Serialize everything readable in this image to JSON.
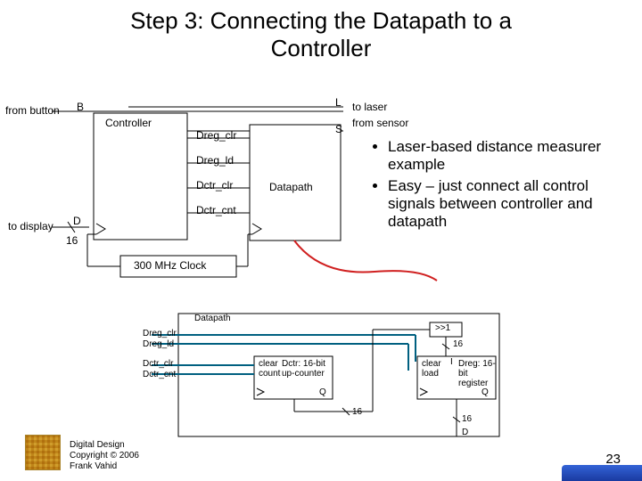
{
  "title_line1": "Step 3: Connecting the Datapath to a",
  "title_line2": "Controller",
  "top": {
    "from_button": "from button",
    "to_display": "to display",
    "B": "B",
    "D": "D",
    "controller": "Controller",
    "datapath": "Datapath",
    "dreg_clr": "Dreg_clr",
    "dreg_ld": "Dreg_ld",
    "dctr_clr": "Dctr_clr",
    "dctr_cnt": "Dctr_cnt",
    "L": "L",
    "S": "S",
    "to_laser": "to laser",
    "from_sensor": "from sensor",
    "bus16": "16",
    "clock": "300 MHz Clock"
  },
  "bullets": [
    "Laser-based distance measurer example",
    "Easy – just connect all control signals between controller and datapath"
  ],
  "bottom": {
    "datapath": "Datapath",
    "dreg_clr": "Dreg_clr",
    "dreg_ld": "Dreg_ld",
    "dctr_clr": "Dctr_clr",
    "dctr_cnt": "Dctr_cnt",
    "clear": "clear",
    "count": "count",
    "load": "load",
    "dctr_box": "Dctr: 16-bit up-counter",
    "dreg_box": "Dreg: 16-bit register",
    "shift": ">>1",
    "Q": "Q",
    "I": "I",
    "D_out": "D",
    "bus16": "16"
  },
  "credit_l1": "Digital Design",
  "credit_l2": "Copyright © 2006",
  "credit_l3": "Frank Vahid",
  "pagenum": "23"
}
